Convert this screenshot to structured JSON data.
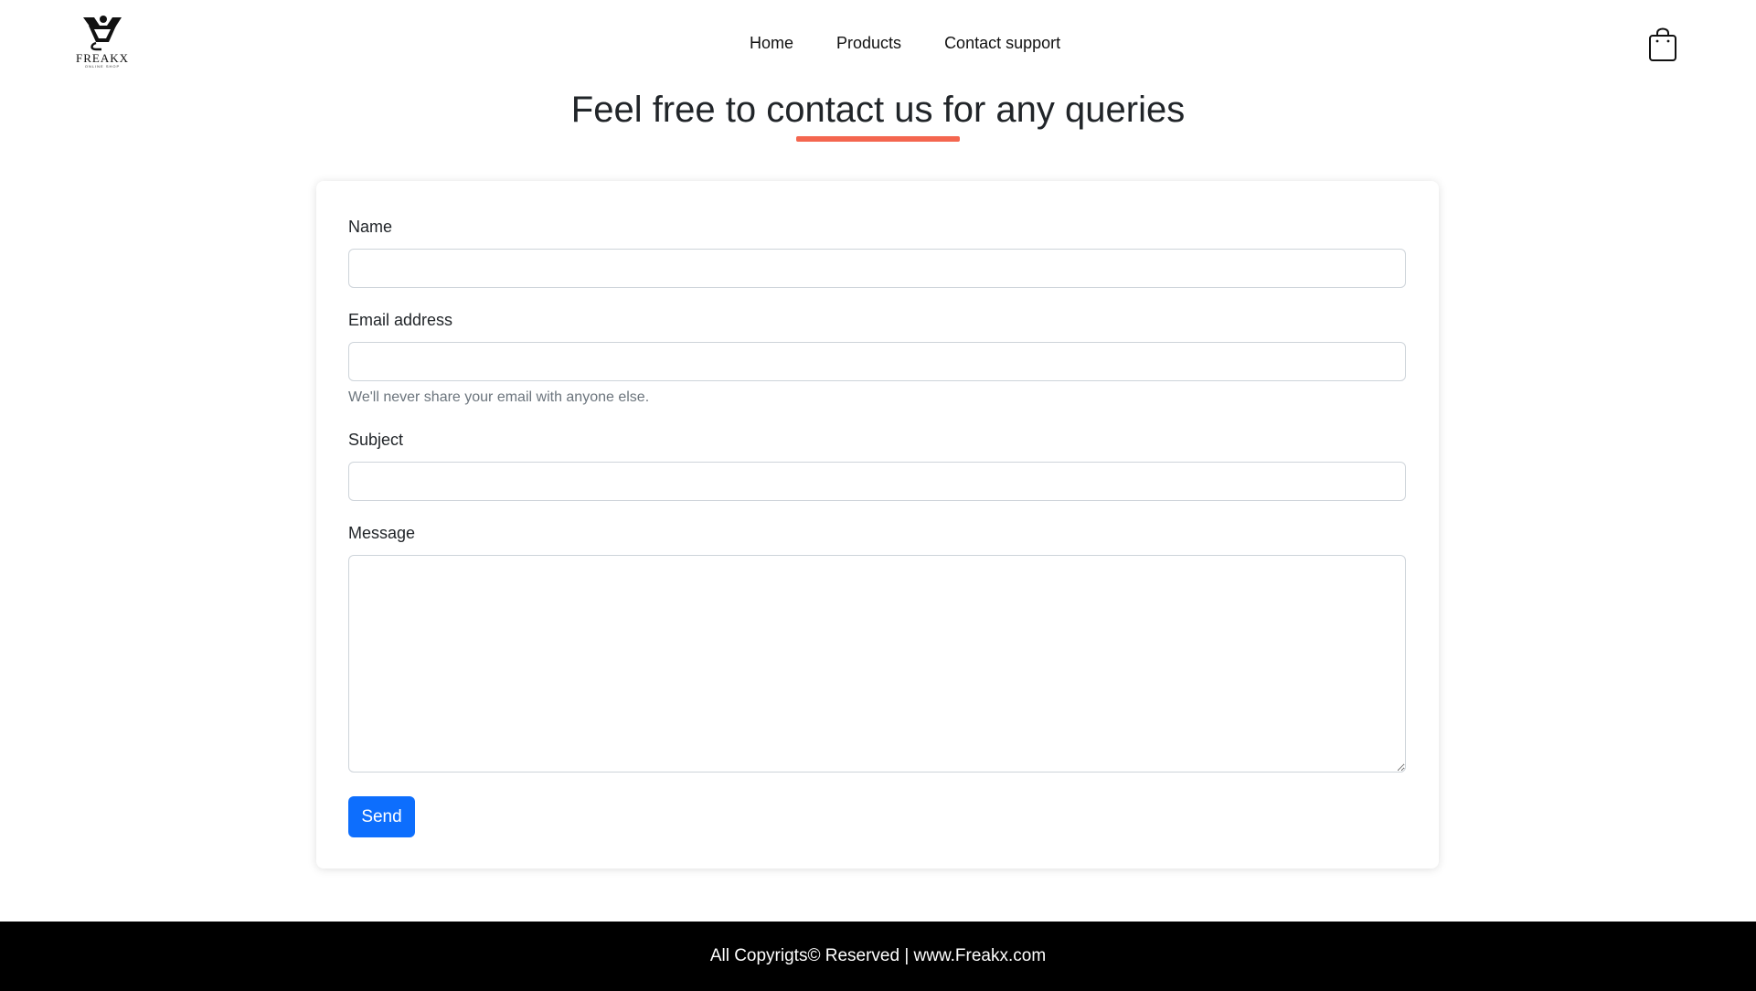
{
  "brand": {
    "name": "FREAKX",
    "tagline": "ONLINE SHOP"
  },
  "nav": {
    "items": [
      "Home",
      "Products",
      "Contact support"
    ]
  },
  "page": {
    "heading": "Feel free to contact us for any queries",
    "accent_color": "#f4664f"
  },
  "form": {
    "name_label": "Name",
    "name_value": "",
    "email_label": "Email address",
    "email_value": "",
    "email_help": "We'll never share your email with anyone else.",
    "subject_label": "Subject",
    "subject_value": "",
    "message_label": "Message",
    "message_value": "",
    "send_label": "Send",
    "button_color": "#0d6efd"
  },
  "footer": {
    "text": "All Copyrigts© Reserved | www.Freakx.com"
  },
  "icons": {
    "logo": "shopping-logo-icon",
    "cart": "shopping-bag-icon"
  }
}
